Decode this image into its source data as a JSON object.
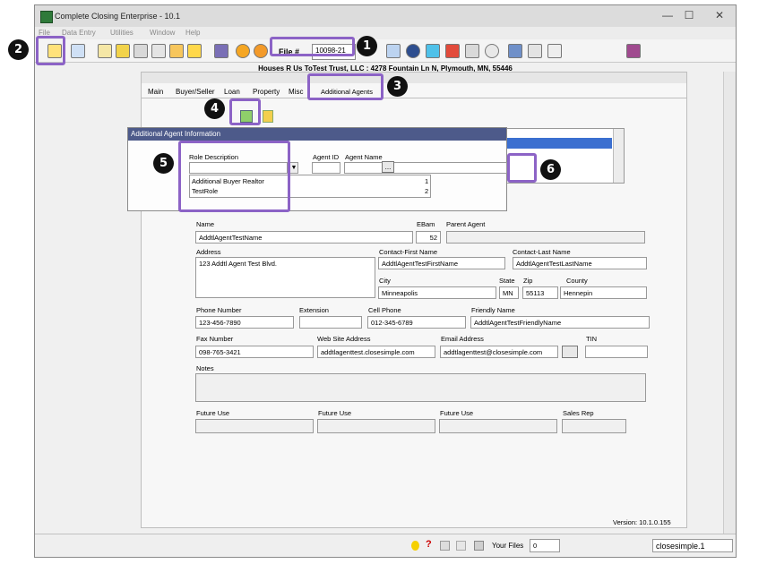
{
  "window": {
    "title": "Complete Closing Enterprise - 10.1",
    "minimize": "—",
    "maximize": "☐",
    "close": "✕"
  },
  "menu": [
    "File",
    "Data Entry",
    "Utilities",
    "Window",
    "Help"
  ],
  "toolbar": {
    "file_label": "File #",
    "file_number": "10098-21"
  },
  "address_bar": "Houses R Us ToTest Trust, LLC : 4278 Fountain Ln N, Plymouth, MN, 55446",
  "tabs": [
    "Main",
    "Buyer/Seller",
    "Loan",
    "Property",
    "Misc",
    "Additional Agents"
  ],
  "popup": {
    "title": "Additional Agent Information",
    "role_description_label": "Role Description",
    "agent_id_label": "Agent ID",
    "agent_name_label": "Agent Name",
    "lookup_button": "...",
    "role_options": [
      {
        "label": "Additional Buyer Realtor",
        "id": "1"
      },
      {
        "label": "TestRole",
        "id": "2"
      }
    ]
  },
  "form": {
    "name_label": "Name",
    "name": "AddtlAgentTestName",
    "ebam_label": "EBam",
    "ebam": "52",
    "parent_agent_label": "Parent Agent",
    "address_label": "Address",
    "address": "123 Addtl Agent Test Blvd.",
    "contact_first_label": "Contact-First Name",
    "contact_first": "AddtlAgentTestFirstName",
    "contact_last_label": "Contact-Last Name",
    "contact_last": "AddtlAgentTestLastName",
    "city_label": "City",
    "city": "Minneapolis",
    "state_label": "State",
    "state": "MN",
    "zip_label": "Zip",
    "zip": "55113",
    "county_label": "County",
    "county": "Hennepin",
    "phone_label": "Phone Number",
    "phone": "123-456-7890",
    "extension_label": "Extension",
    "cell_label": "Cell Phone",
    "cell": "012-345-6789",
    "friendly_label": "Friendly Name",
    "friendly": "AddtlAgentTestFriendlyName",
    "fax_label": "Fax Number",
    "fax": "098-765-3421",
    "website_label": "Web Site Address",
    "website": "addtlagenttest.closesimple.com",
    "email_label": "Email Address",
    "email": "addtlagenttest@closesimple.com",
    "tin_label": "TIN",
    "notes_label": "Notes",
    "future_use_label": "Future Use",
    "sales_rep_label": "Sales Rep"
  },
  "version": "Version:  10.1.0.155",
  "status": {
    "your_files_label": "Your Files",
    "your_files_value": "0",
    "user": "closesimple.1"
  },
  "callouts": [
    "1",
    "2",
    "3",
    "4",
    "5",
    "6"
  ],
  "colors": {
    "highlight": "#8c63c6",
    "popup_title_bg": "#4d5a8a",
    "selection": "#3b6fd0"
  }
}
